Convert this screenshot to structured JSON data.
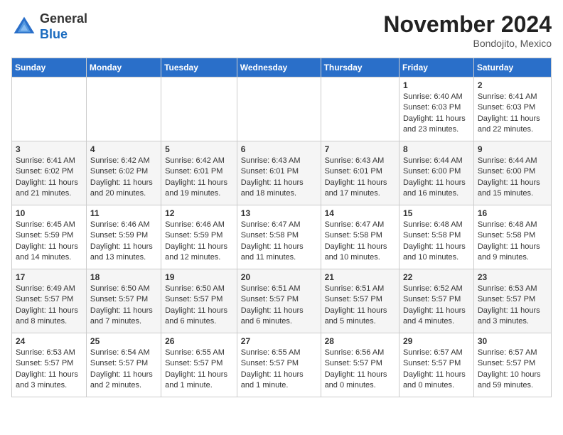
{
  "header": {
    "logo_line1": "General",
    "logo_line2": "Blue",
    "month": "November 2024",
    "location": "Bondojito, Mexico"
  },
  "days_of_week": [
    "Sunday",
    "Monday",
    "Tuesday",
    "Wednesday",
    "Thursday",
    "Friday",
    "Saturday"
  ],
  "weeks": [
    [
      {
        "day": "",
        "info": ""
      },
      {
        "day": "",
        "info": ""
      },
      {
        "day": "",
        "info": ""
      },
      {
        "day": "",
        "info": ""
      },
      {
        "day": "",
        "info": ""
      },
      {
        "day": "1",
        "info": "Sunrise: 6:40 AM\nSunset: 6:03 PM\nDaylight: 11 hours and 23 minutes."
      },
      {
        "day": "2",
        "info": "Sunrise: 6:41 AM\nSunset: 6:03 PM\nDaylight: 11 hours and 22 minutes."
      }
    ],
    [
      {
        "day": "3",
        "info": "Sunrise: 6:41 AM\nSunset: 6:02 PM\nDaylight: 11 hours and 21 minutes."
      },
      {
        "day": "4",
        "info": "Sunrise: 6:42 AM\nSunset: 6:02 PM\nDaylight: 11 hours and 20 minutes."
      },
      {
        "day": "5",
        "info": "Sunrise: 6:42 AM\nSunset: 6:01 PM\nDaylight: 11 hours and 19 minutes."
      },
      {
        "day": "6",
        "info": "Sunrise: 6:43 AM\nSunset: 6:01 PM\nDaylight: 11 hours and 18 minutes."
      },
      {
        "day": "7",
        "info": "Sunrise: 6:43 AM\nSunset: 6:01 PM\nDaylight: 11 hours and 17 minutes."
      },
      {
        "day": "8",
        "info": "Sunrise: 6:44 AM\nSunset: 6:00 PM\nDaylight: 11 hours and 16 minutes."
      },
      {
        "day": "9",
        "info": "Sunrise: 6:44 AM\nSunset: 6:00 PM\nDaylight: 11 hours and 15 minutes."
      }
    ],
    [
      {
        "day": "10",
        "info": "Sunrise: 6:45 AM\nSunset: 5:59 PM\nDaylight: 11 hours and 14 minutes."
      },
      {
        "day": "11",
        "info": "Sunrise: 6:46 AM\nSunset: 5:59 PM\nDaylight: 11 hours and 13 minutes."
      },
      {
        "day": "12",
        "info": "Sunrise: 6:46 AM\nSunset: 5:59 PM\nDaylight: 11 hours and 12 minutes."
      },
      {
        "day": "13",
        "info": "Sunrise: 6:47 AM\nSunset: 5:58 PM\nDaylight: 11 hours and 11 minutes."
      },
      {
        "day": "14",
        "info": "Sunrise: 6:47 AM\nSunset: 5:58 PM\nDaylight: 11 hours and 10 minutes."
      },
      {
        "day": "15",
        "info": "Sunrise: 6:48 AM\nSunset: 5:58 PM\nDaylight: 11 hours and 10 minutes."
      },
      {
        "day": "16",
        "info": "Sunrise: 6:48 AM\nSunset: 5:58 PM\nDaylight: 11 hours and 9 minutes."
      }
    ],
    [
      {
        "day": "17",
        "info": "Sunrise: 6:49 AM\nSunset: 5:57 PM\nDaylight: 11 hours and 8 minutes."
      },
      {
        "day": "18",
        "info": "Sunrise: 6:50 AM\nSunset: 5:57 PM\nDaylight: 11 hours and 7 minutes."
      },
      {
        "day": "19",
        "info": "Sunrise: 6:50 AM\nSunset: 5:57 PM\nDaylight: 11 hours and 6 minutes."
      },
      {
        "day": "20",
        "info": "Sunrise: 6:51 AM\nSunset: 5:57 PM\nDaylight: 11 hours and 6 minutes."
      },
      {
        "day": "21",
        "info": "Sunrise: 6:51 AM\nSunset: 5:57 PM\nDaylight: 11 hours and 5 minutes."
      },
      {
        "day": "22",
        "info": "Sunrise: 6:52 AM\nSunset: 5:57 PM\nDaylight: 11 hours and 4 minutes."
      },
      {
        "day": "23",
        "info": "Sunrise: 6:53 AM\nSunset: 5:57 PM\nDaylight: 11 hours and 3 minutes."
      }
    ],
    [
      {
        "day": "24",
        "info": "Sunrise: 6:53 AM\nSunset: 5:57 PM\nDaylight: 11 hours and 3 minutes."
      },
      {
        "day": "25",
        "info": "Sunrise: 6:54 AM\nSunset: 5:57 PM\nDaylight: 11 hours and 2 minutes."
      },
      {
        "day": "26",
        "info": "Sunrise: 6:55 AM\nSunset: 5:57 PM\nDaylight: 11 hours and 1 minute."
      },
      {
        "day": "27",
        "info": "Sunrise: 6:55 AM\nSunset: 5:57 PM\nDaylight: 11 hours and 1 minute."
      },
      {
        "day": "28",
        "info": "Sunrise: 6:56 AM\nSunset: 5:57 PM\nDaylight: 11 hours and 0 minutes."
      },
      {
        "day": "29",
        "info": "Sunrise: 6:57 AM\nSunset: 5:57 PM\nDaylight: 11 hours and 0 minutes."
      },
      {
        "day": "30",
        "info": "Sunrise: 6:57 AM\nSunset: 5:57 PM\nDaylight: 10 hours and 59 minutes."
      }
    ]
  ]
}
